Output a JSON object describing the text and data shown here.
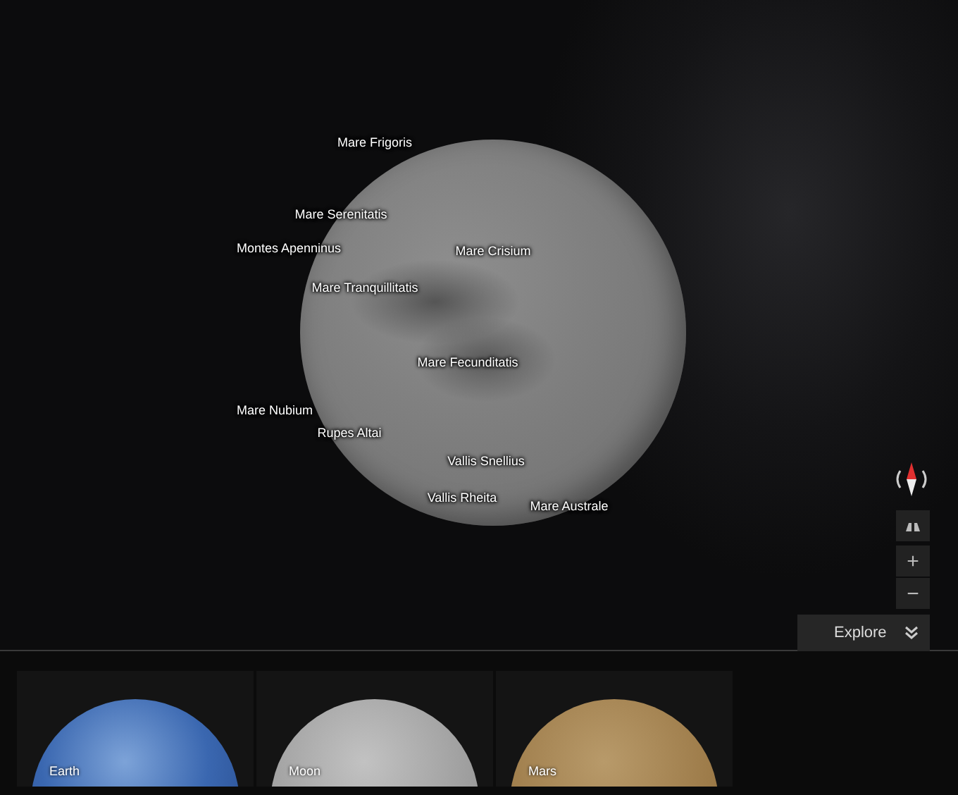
{
  "map_labels": [
    "Mare Frigoris",
    "Mare Serenitatis",
    "Montes Apenninus",
    "Mare Crisium",
    "Mare Tranquillitatis",
    "Mare Fecunditatis",
    "Mare Nubium",
    "Rupes Altai",
    "Vallis Snellius",
    "Vallis Rheita",
    "Mare Australe"
  ],
  "controls": {
    "zoom_in": "+",
    "zoom_out": "−"
  },
  "explore_button": {
    "label": "Explore"
  },
  "planets": [
    {
      "label": "Earth",
      "kind": "earth"
    },
    {
      "label": "Moon",
      "kind": "moon"
    },
    {
      "label": "Mars",
      "kind": "mars"
    }
  ]
}
